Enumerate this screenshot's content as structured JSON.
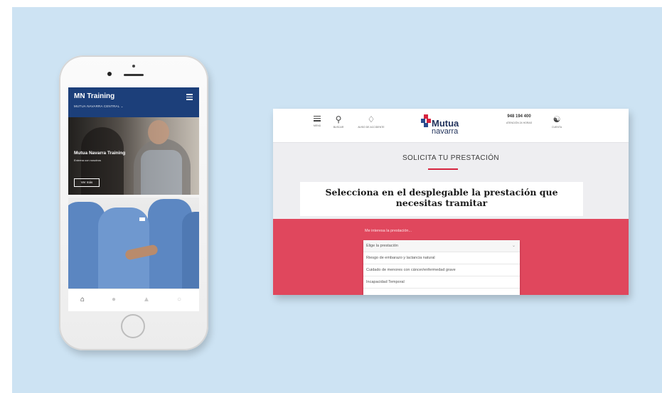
{
  "phone_app": {
    "title": "MN Training",
    "subtitle": "MUTUA NAVARRA CENTRAL ⌄",
    "card1": {
      "title": "Mutua Navarra Training",
      "subtitle": "Entrena con nosotros",
      "button": "Ver más"
    },
    "tabs": [
      {
        "icon": "home-icon",
        "glyph": "⌂"
      },
      {
        "icon": "activity-icon",
        "glyph": "●"
      },
      {
        "icon": "chart-icon",
        "glyph": "▲"
      },
      {
        "icon": "profile-icon",
        "glyph": "○"
      }
    ]
  },
  "website": {
    "header": {
      "menu_label": "MENÚ",
      "search_label": "BUSCAR",
      "notice_label": "AVISO DE ACCIDENTE",
      "brand_word1": "Mutua",
      "brand_word2": "navarra",
      "phone_number": "948 194 400",
      "phone_label": "ATENCIÓN 24 HORAS",
      "bag_label": "CUENTA"
    },
    "page_title": "SOLICITA TU PRESTACIÓN",
    "heading_line1": "Selecciona en el desplegable la prestación que",
    "heading_line2": "necesitas tramitar",
    "select_label": "Me interesa la prestación...",
    "dropdown": {
      "selected": "Elige la prestación",
      "options": [
        "Riesgo de embarazo y lactancia natural",
        "Cuidado de menores con cáncer/enfermedad grave",
        "Incapacidad Temporal"
      ]
    },
    "colors": {
      "brand_red": "#d6243f",
      "brand_navy": "#22335c",
      "band_red": "#e0475d",
      "app_blue": "#1c3f7a"
    }
  }
}
